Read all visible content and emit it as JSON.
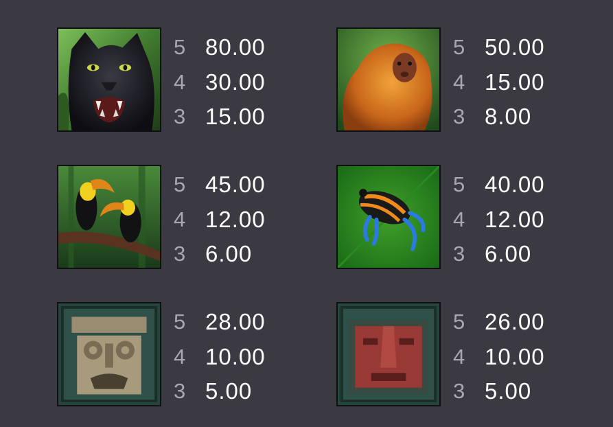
{
  "paytable": [
    {
      "symbol": "black-panther",
      "icon": "black-panther-icon",
      "pays": [
        {
          "count": "5",
          "amount": "80.00"
        },
        {
          "count": "4",
          "amount": "30.00"
        },
        {
          "count": "3",
          "amount": "15.00"
        }
      ]
    },
    {
      "symbol": "golden-lion-tamarin",
      "icon": "golden-monkey-icon",
      "pays": [
        {
          "count": "5",
          "amount": "50.00"
        },
        {
          "count": "4",
          "amount": "15.00"
        },
        {
          "count": "3",
          "amount": "8.00"
        }
      ]
    },
    {
      "symbol": "toucans",
      "icon": "toucans-icon",
      "pays": [
        {
          "count": "5",
          "amount": "45.00"
        },
        {
          "count": "4",
          "amount": "12.00"
        },
        {
          "count": "3",
          "amount": "6.00"
        }
      ]
    },
    {
      "symbol": "poison-dart-frog",
      "icon": "poison-frog-icon",
      "pays": [
        {
          "count": "5",
          "amount": "40.00"
        },
        {
          "count": "4",
          "amount": "12.00"
        },
        {
          "count": "3",
          "amount": "6.00"
        }
      ]
    },
    {
      "symbol": "stone-mask",
      "icon": "stone-mask-icon",
      "pays": [
        {
          "count": "5",
          "amount": "28.00"
        },
        {
          "count": "4",
          "amount": "10.00"
        },
        {
          "count": "3",
          "amount": "5.00"
        }
      ]
    },
    {
      "symbol": "red-stone-mask",
      "icon": "red-stone-mask-icon",
      "pays": [
        {
          "count": "5",
          "amount": "26.00"
        },
        {
          "count": "4",
          "amount": "10.00"
        },
        {
          "count": "3",
          "amount": "5.00"
        }
      ]
    }
  ],
  "colors": {
    "background": "#3b3a42",
    "count": "#a8a8ae",
    "amount": "#ffffff"
  }
}
